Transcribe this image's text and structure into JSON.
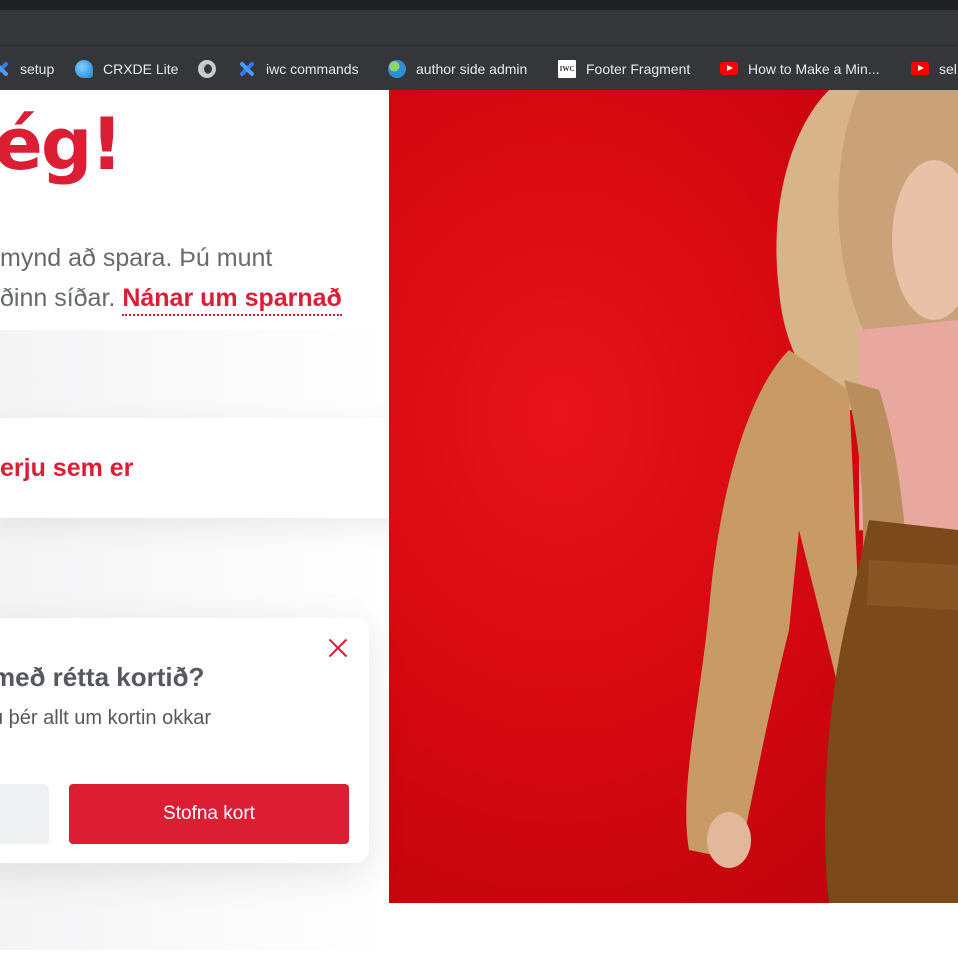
{
  "browser": {
    "bookmarks": [
      {
        "label": "setup",
        "icon": "cross-blue-icon"
      },
      {
        "label": "CRXDE Lite",
        "icon": "crxde-icon"
      },
      {
        "label": "",
        "icon": "globe-icon"
      },
      {
        "label": "iwc commands",
        "icon": "cross-blue-icon"
      },
      {
        "label": "author side admin",
        "icon": "earth-icon"
      },
      {
        "label": "Footer Fragment",
        "icon": "iwc-logo-icon"
      },
      {
        "label": "How to Make a Min...",
        "icon": "youtube-icon"
      },
      {
        "label": "sel",
        "icon": "youtube-icon"
      }
    ]
  },
  "hero": {
    "headline": "ég!",
    "intro_line1": "mynd að spara. Þú munt",
    "intro_line2": "ðinn síðar.",
    "intro_link": "Nánar um sparnað",
    "card_button_label": "erju sem er"
  },
  "popup": {
    "title": "með rétta kortið?",
    "text": "u þér allt um kortin okkar",
    "primary_button": "Stofna kort"
  },
  "colors": {
    "brand_red": "#dc1e35",
    "hero_background": "#d60810",
    "chrome_dark": "#35363a"
  }
}
